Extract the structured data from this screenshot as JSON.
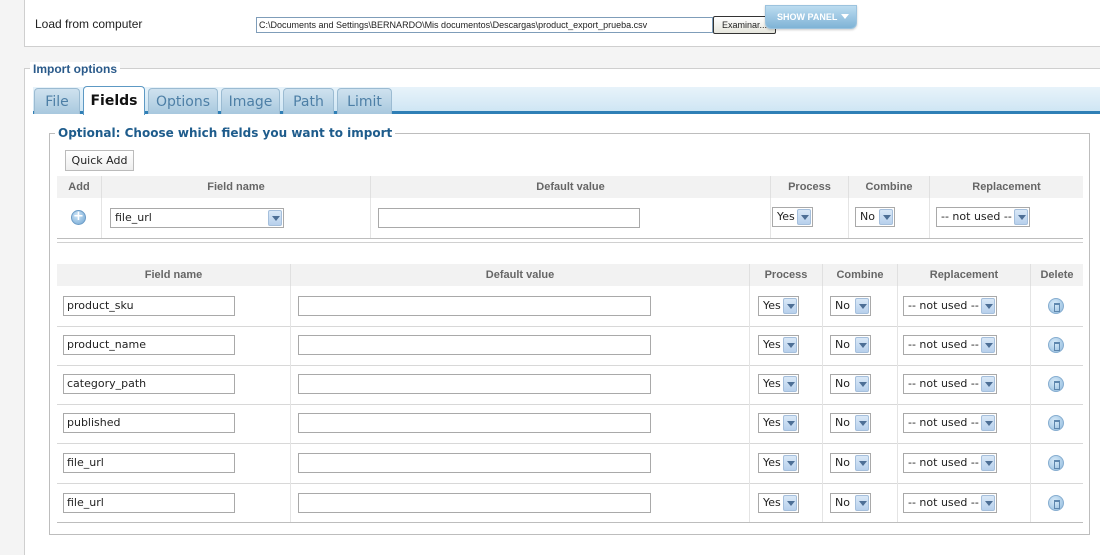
{
  "load": {
    "label": "Load from computer",
    "file_path": "C:\\Documents and Settings\\BERNARDO\\Mis documentos\\Descargas\\product_export_prueba.csv",
    "browse_label": "Examinar...",
    "show_panel_label": "SHOW PANEL"
  },
  "import_options": {
    "legend": "Import options",
    "tabs": [
      {
        "label": "File"
      },
      {
        "label": "Fields"
      },
      {
        "label": "Options"
      },
      {
        "label": "Image"
      },
      {
        "label": "Path"
      },
      {
        "label": "Limit"
      }
    ],
    "active_tab": "Fields"
  },
  "optional": {
    "legend": "Optional: Choose which fields you want to import",
    "quick_add_label": "Quick Add",
    "add_headers": {
      "add": "Add",
      "field_name": "Field name",
      "default_value": "Default value",
      "process": "Process",
      "combine": "Combine",
      "replacement": "Replacement"
    },
    "add_row": {
      "field": "file_url",
      "default_value": "",
      "process": "Yes",
      "combine": "No",
      "replacement": "-- not used --"
    },
    "list_headers": {
      "field_name": "Field name",
      "default_value": "Default value",
      "process": "Process",
      "combine": "Combine",
      "replacement": "Replacement",
      "delete": "Delete"
    },
    "rows": [
      {
        "field": "product_sku",
        "default_value": "",
        "process": "Yes",
        "combine": "No",
        "replacement": "-- not used --"
      },
      {
        "field": "product_name",
        "default_value": "",
        "process": "Yes",
        "combine": "No",
        "replacement": "-- not used --"
      },
      {
        "field": "category_path",
        "default_value": "",
        "process": "Yes",
        "combine": "No",
        "replacement": "-- not used --"
      },
      {
        "field": "published",
        "default_value": "",
        "process": "Yes",
        "combine": "No",
        "replacement": "-- not used --"
      },
      {
        "field": "file_url",
        "default_value": "",
        "process": "Yes",
        "combine": "No",
        "replacement": "-- not used --"
      },
      {
        "field": "file_url",
        "default_value": "",
        "process": "Yes",
        "combine": "No",
        "replacement": "-- not used --"
      }
    ]
  }
}
